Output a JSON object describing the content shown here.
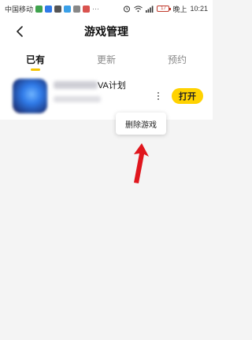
{
  "status_bar": {
    "carrier": "中国移动",
    "time_prefix": "晚上",
    "time": "10:21",
    "battery": "17"
  },
  "header": {
    "title": "游戏管理"
  },
  "tabs": [
    {
      "label": "已有",
      "active": true
    },
    {
      "label": "更新",
      "active": false
    },
    {
      "label": "预约",
      "active": false
    }
  ],
  "game": {
    "name_visible": "VA计划",
    "open_label": "打开"
  },
  "popup": {
    "delete_label": "删除游戏"
  },
  "colors": {
    "accent": "#ffd200",
    "arrow": "#e0161d",
    "background": "#f4f4f4"
  }
}
